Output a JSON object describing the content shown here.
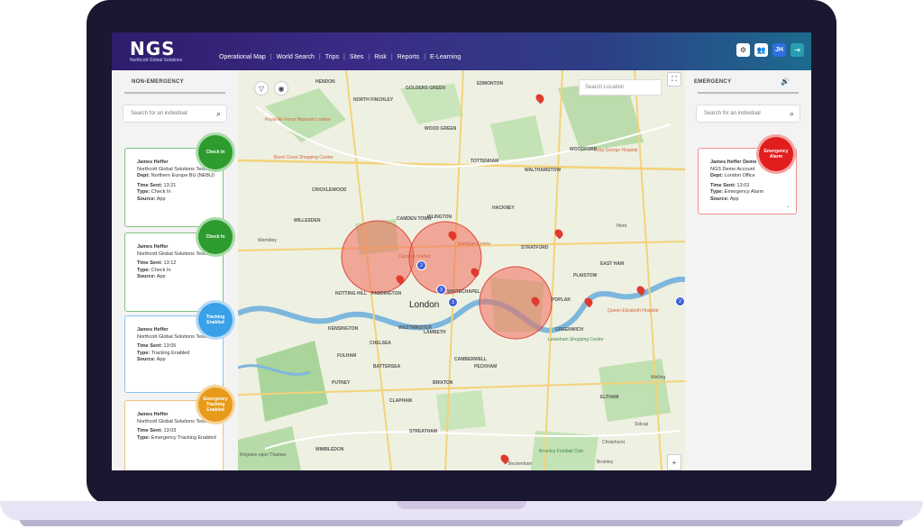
{
  "app": {
    "logo_text": "NGS",
    "logo_sub": "Northcott Global Solutions"
  },
  "nav": [
    "Operational Map",
    "World Search",
    "Trips",
    "Sites",
    "Risk",
    "Reports",
    "E-Learning"
  ],
  "topbar": {
    "user_initials": "JH",
    "icons": [
      "gear-icon",
      "users-icon",
      "user-initials",
      "exit-icon"
    ]
  },
  "left_panel": {
    "title": "NON-EMERGENCY",
    "search_placeholder": "Search for an individual",
    "cards": [
      {
        "name": "James Heffer",
        "company": "Northcott Global Solutions Testing",
        "dept_label": "Dept:",
        "dept": "Northern Europe BU (NEBU)",
        "time_label": "Time Sent:",
        "time": "13:21",
        "type_label": "Type:",
        "type": "Check In",
        "source_label": "Source:",
        "source": "App",
        "badge": "Check In",
        "color": "#2e9b2e"
      },
      {
        "name": "James Heffer",
        "company": "Northcott Global Solutions Testing",
        "time_label": "Time Sent:",
        "time": "13:12",
        "type_label": "Type:",
        "type": "Check In",
        "source_label": "Source:",
        "source": "App",
        "badge": "Check In",
        "color": "#2e9b2e"
      },
      {
        "name": "James Heffer",
        "company": "Northcott Global Solutions Testing",
        "time_label": "Time Sent:",
        "time": "13:05",
        "type_label": "Type:",
        "type": "Tracking Enabled",
        "source_label": "Source:",
        "source": "App",
        "badge": "Tracking Enabled",
        "color": "#3aa0e8"
      },
      {
        "name": "James Heffer",
        "company": "Northcott Global Solutions Testing",
        "time_label": "Time Sent:",
        "time": "13:03",
        "type_label": "Type:",
        "type": "Emergency Tracking Enabled",
        "badge": "Emergency Tracking Enabled",
        "color": "#e89a1a"
      }
    ]
  },
  "right_panel": {
    "title": "EMERGENCY",
    "search_placeholder": "Search for an individual",
    "cards": [
      {
        "name": "James Heffer Demo",
        "company": "NGS Demo Account",
        "dept_label": "Dept:",
        "dept": "London Office",
        "time_label": "Time Sent:",
        "time": "13:03",
        "type_label": "Type:",
        "type": "Emergency Alarm",
        "source_label": "Source:",
        "source": "App",
        "badge": "Emergency Alarm",
        "color": "#e21d1d"
      }
    ]
  },
  "map": {
    "search_placeholder": "Search Location",
    "labels": {
      "london": "London",
      "golders_green": "GOLDERS GREEN",
      "hendon": "HENDON",
      "north_finchley": "NORTH FINCHLEY",
      "wood_green": "WOOD GREEN",
      "edmonton": "EDMONTON",
      "tottenham": "TOTTENHAM",
      "walthamstow": "WALTHAMSTOW",
      "woodford": "WOODFORD",
      "ilford": "Ilford",
      "cricklewood": "CRICKLEWOOD",
      "willesden": "WILLESDEN",
      "camden_town": "CAMDEN TOWN",
      "islington": "ISLINGTON",
      "hackney": "HACKNEY",
      "stratford": "STRATFORD",
      "east_ham": "EAST HAM",
      "plaistow": "PLAISTOW",
      "notting_hill": "NOTTING HILL",
      "paddington": "PADDINGTON",
      "whitechapel": "WHITECHAPEL",
      "poplar": "POPLAR",
      "westminster": "WESTMINSTER",
      "lambeth": "LAMBETH",
      "kensington": "KENSINGTON",
      "chelsea": "CHELSEA",
      "fulham": "FULHAM",
      "battersea": "BATTERSEA",
      "camberwell": "CAMBERWELL",
      "peckham": "PECKHAM",
      "greenwich": "GREENWICH",
      "putney": "PUTNEY",
      "brixton": "BRIXTON",
      "clapham": "CLAPHAM",
      "streatham": "STREATHAM",
      "wimbledon": "WIMBLEDON",
      "beckenham": "Beckenham",
      "bromley": "Bromley",
      "welling": "Welling",
      "eltham": "ELTHAM",
      "chislehurst": "Chislehurst",
      "sidcup": "Sidcup",
      "kingston": "Kingston upon Thames",
      "lewisham": "Lewisham Shopping Centre",
      "queen_elizabeth": "Queen Elizabeth Hospital",
      "king_george": "King George Hospital",
      "wembley": "Wembley",
      "royal_air_force": "Royal Air Force Museum London",
      "brent_cross": "Brent Cross Shopping Centre",
      "camden_market": "Camden Market",
      "barbican": "Barbican Centre",
      "bromley_fc": "Bromley Football Club"
    },
    "cluster_counts": [
      "2",
      "3",
      "3",
      "2"
    ]
  }
}
